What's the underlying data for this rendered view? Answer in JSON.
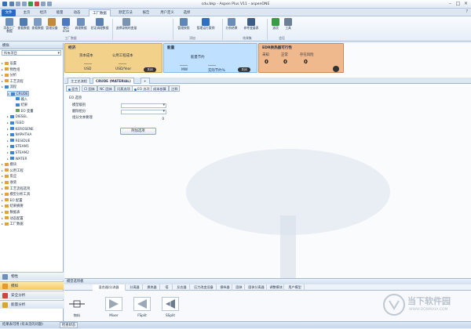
{
  "window": {
    "title": "cdu.bkp - Aspen Plus V11 - aspenONE"
  },
  "menubar": {
    "tabs": [
      "文件",
      "主页",
      "经济",
      "能量",
      "动态",
      "工厂数据",
      "默定方法",
      "报告",
      "用户定义",
      "选择"
    ]
  },
  "ribbon": {
    "buttons": [
      {
        "label": "添和工厂数据",
        "icon": "tank-icon",
        "color": "#6b8fbd"
      },
      {
        "label": "查看数据",
        "icon": "grid-icon",
        "color": "#4f7bb3"
      },
      {
        "label": "查看数据",
        "icon": "table-icon",
        "color": "#7b9bc4"
      },
      {
        "label": "管理设备",
        "icon": "wrench-icon",
        "color": "#c48a3a"
      },
      {
        "label": "使用EOM",
        "icon": "eom-icon",
        "color": "#4c79bf"
      },
      {
        "label": "调理数据",
        "icon": "chart-icon",
        "color": "#6d8fbb"
      },
      {
        "label": "验证调理数据",
        "icon": "check-icon",
        "color": "#5b7fae"
      },
      {
        "label": "选择录制的变量",
        "icon": "var-icon",
        "color": "#7b93b3"
      },
      {
        "label": "管理按照",
        "icon": "manage-icon",
        "color": "#5f86b8"
      },
      {
        "label": "管理运行案例",
        "icon": "run-icon",
        "color": "#2f6fc2"
      },
      {
        "label": "分析结果",
        "icon": "analysis-icon",
        "color": "#6a8db8"
      },
      {
        "label": "参考变量表",
        "icon": "variable-icon",
        "color": "#3d5c87"
      },
      {
        "label": "选项",
        "icon": "check-mark-icon",
        "color": "#3b9a45"
      },
      {
        "label": "工具",
        "icon": "tools-icon",
        "color": "#6c7f95"
      }
    ],
    "groups": [
      "工厂数据",
      "添加",
      "结果集",
      "会话"
    ]
  },
  "navigation": {
    "header": "模拟",
    "combo_value": "所有项目",
    "tree": [
      {
        "label": "设置",
        "indent": 0,
        "color": "#e2a23a"
      },
      {
        "label": "物性组",
        "indent": 0,
        "color": "#e2a23a"
      },
      {
        "label": "分析",
        "indent": 0,
        "color": "#e2a23a"
      },
      {
        "label": "工艺流程",
        "indent": 0,
        "color": "#e2a23a"
      },
      {
        "label": "流程",
        "indent": 0,
        "color": "#3c86d4"
      },
      {
        "label": "CRUDE",
        "indent": 1,
        "color": "#3c86d4",
        "selected": true
      },
      {
        "label": "输入",
        "indent": 2,
        "color": "#3c86d4"
      },
      {
        "label": "结果",
        "indent": 2,
        "color": "#3c86d4"
      },
      {
        "label": "EO 变量",
        "indent": 2,
        "color": "#6aa25b"
      },
      {
        "label": "DIESEL",
        "indent": 1,
        "color": "#3c86d4"
      },
      {
        "label": "FEED",
        "indent": 1,
        "color": "#3c86d4"
      },
      {
        "label": "KEROSENE",
        "indent": 1,
        "color": "#3c86d4"
      },
      {
        "label": "NAPHTHA",
        "indent": 1,
        "color": "#3c86d4"
      },
      {
        "label": "RESIDUE",
        "indent": 1,
        "color": "#3c86d4"
      },
      {
        "label": "STEAM1",
        "indent": 1,
        "color": "#3c86d4"
      },
      {
        "label": "STEAM2",
        "indent": 1,
        "color": "#3c86d4"
      },
      {
        "label": "WATER",
        "indent": 1,
        "color": "#3c86d4"
      },
      {
        "label": "模块",
        "indent": 0,
        "color": "#e2a23a"
      },
      {
        "label": "公用工程",
        "indent": 0,
        "color": "#e2a23a"
      },
      {
        "label": "反应",
        "indent": 0,
        "color": "#e2a23a"
      },
      {
        "label": "收敛",
        "indent": 0,
        "color": "#e2a23a"
      },
      {
        "label": "工艺流程选项",
        "indent": 0,
        "color": "#e2a23a"
      },
      {
        "label": "模型分析工具",
        "indent": 0,
        "color": "#e2a23a"
      },
      {
        "label": "EO 配置",
        "indent": 0,
        "color": "#e2a23a"
      },
      {
        "label": "结果摘要",
        "indent": 0,
        "color": "#e2a23a"
      },
      {
        "label": "数据表",
        "indent": 0,
        "color": "#e2a23a"
      },
      {
        "label": "动态配置",
        "indent": 0,
        "color": "#e2a23a"
      },
      {
        "label": "工厂数据",
        "indent": 0,
        "color": "#e2a23a"
      }
    ],
    "buttons": [
      {
        "label": "物性",
        "icon": "properties-icon",
        "color": "#6e8fb8"
      },
      {
        "label": "模拟",
        "icon": "simulation-icon",
        "color": "#e59a2b",
        "active": true
      },
      {
        "label": "安全分析",
        "icon": "safety-icon",
        "color": "#c94a3b"
      },
      {
        "label": "能量分析",
        "icon": "energy-icon",
        "color": "#d9a532"
      }
    ]
  },
  "dashboard": {
    "cards": [
      {
        "title": "经济",
        "color": "#f2d18b",
        "labels": [
          "资本成本",
          "公用工程成本"
        ],
        "values": [
          "____",
          "____"
        ],
        "units": [
          "USD",
          "USD/Year"
        ],
        "toggle": "关闭"
      },
      {
        "title": "能量",
        "color": "#bfe0ff",
        "labels": [
          "",
          "能量节约"
        ],
        "values": [
          "____",
          "____"
        ],
        "units": [
          "MW",
          "实际节约%"
        ],
        "toggle": "关闭"
      },
      {
        "title": "EDR换热器可行性",
        "color": "#f0b98d",
        "labels": [
          "未知",
          "正常",
          "存在风险"
        ],
        "values": [
          "0",
          "0",
          "0"
        ]
      }
    ]
  },
  "doc_tabs": [
    "主工艺流程",
    "CRUDE (MATERIAL)",
    "+"
  ],
  "form_tabs": [
    "混合",
    "CI 固体",
    "NC 固体",
    "闪蒸选项",
    "EO 选项",
    "成本核算",
    "注释"
  ],
  "form": {
    "section": "EO 选项",
    "fields": [
      {
        "label": "模型级别",
        "value": ""
      },
      {
        "label": "删除组分",
        "value": ""
      },
      {
        "label": "组分文本要理",
        "value": "0"
      }
    ],
    "button": "附加选项"
  },
  "palette": {
    "header": "模型选项板",
    "tabs": [
      "混合器/分流器",
      "分离器",
      "换热器",
      "塔",
      "反应器",
      "压力改变设备",
      "操纵器",
      "固体",
      "固体分离器",
      "调整模块",
      "用户模型"
    ],
    "blocks": [
      {
        "label": "物料"
      },
      {
        "label": "Mixer"
      },
      {
        "label": "FSplit"
      },
      {
        "label": "SSplit"
      }
    ]
  },
  "statusbar": {
    "items": [
      "结果表可用 (有未见的问题)",
      "检查状态"
    ]
  },
  "watermark": {
    "label": "当下软件园",
    "sublabel": "WWW.DOWNXIA.COM"
  }
}
